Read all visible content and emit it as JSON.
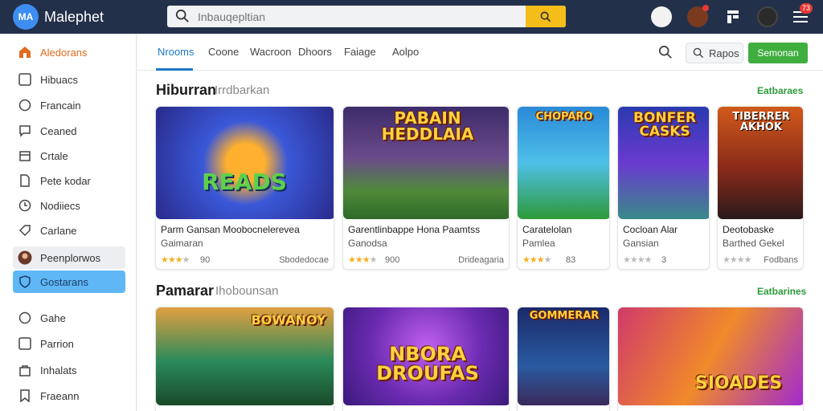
{
  "app": {
    "name": "Malephet",
    "logo_text": "MA"
  },
  "search": {
    "placeholder": "Inbauqepltian"
  },
  "topbar": {
    "badge1": "",
    "badge2": "73"
  },
  "sidebar": {
    "items": [
      {
        "label": "Aledorans",
        "icon": "home-icon"
      },
      {
        "label": "Hibuacs",
        "icon": "square-icon"
      },
      {
        "label": "Francain",
        "icon": "circle-icon"
      },
      {
        "label": "Ceaned",
        "icon": "chat-icon"
      },
      {
        "label": "Crtale",
        "icon": "box-icon"
      },
      {
        "label": "Pete kodar",
        "icon": "document-icon"
      },
      {
        "label": "Nodiiecs",
        "icon": "clock-icon"
      },
      {
        "label": "Carlane",
        "icon": "tag-icon"
      },
      {
        "label": "Peenplorwos",
        "icon": "avatar-icon"
      },
      {
        "label": "Gostarans",
        "icon": "shield-icon"
      },
      {
        "label": "Gahe",
        "icon": "circle-icon"
      },
      {
        "label": "Parrion",
        "icon": "square-icon"
      },
      {
        "label": "Inhalats",
        "icon": "bag-icon"
      },
      {
        "label": "Fraeann",
        "icon": "bookmark-icon"
      }
    ]
  },
  "tabs": [
    {
      "label": "Nrooms",
      "active": true
    },
    {
      "label": "Coone"
    },
    {
      "label": "Wacroon"
    },
    {
      "label": "Dhoors"
    },
    {
      "label": "Faiage"
    },
    {
      "label": "Aolpo"
    }
  ],
  "toolbar": {
    "report_label": "Rapos",
    "action_label": "Semonan"
  },
  "sections": [
    {
      "title": "Hiburran",
      "subtitle": "Irrdbarkan",
      "more": "Eatbaraes",
      "cards": [
        {
          "thumb_text": "READS",
          "title": "Parm  Gansan Moobocnelerevea",
          "subtitle": "Gaimaran",
          "stars": 3,
          "rating": "90",
          "meta": "Sbodedocae",
          "tag": ""
        },
        {
          "thumb_text": "PABAIN HEDDLAIA",
          "title": "Garentlinbappe Hona Paamtss",
          "subtitle": "Ganodsa",
          "stars": 3,
          "rating": "900",
          "meta": "Drideagaria",
          "tag": ""
        },
        {
          "thumb_text": "CHOPARO",
          "title": "Caratelolan",
          "subtitle": "Pamlea",
          "stars": 3,
          "rating": "83",
          "meta": "",
          "tag": ""
        },
        {
          "thumb_text": "BONFER CASKS",
          "title": "Cocloan Alar",
          "subtitle": "Gansian",
          "stars": 0,
          "rating": "3",
          "meta": "",
          "tag": ""
        },
        {
          "thumb_text": "TIBERRER AKHOK",
          "title": "Deotobaske",
          "subtitle": "Barthed Gekel",
          "stars": 0,
          "rating": "",
          "meta": "Fodbans",
          "tag": ""
        }
      ]
    },
    {
      "title": "Pamarar",
      "subtitle": "Ihobounsan",
      "more": "Eatbarines",
      "cards": [
        {
          "thumb_text": "BOWANOY"
        },
        {
          "thumb_text": "NBORA DROUFAS"
        },
        {
          "thumb_text": "GOMMERAR"
        },
        {
          "thumb_text": "SIOADES"
        }
      ]
    }
  ],
  "colors": {
    "topbar": "#23304a",
    "accent": "#1e78c8",
    "green": "#3fae3f",
    "search_btn": "#f4bd1a",
    "active_sidebar": "#5fb8f5"
  }
}
